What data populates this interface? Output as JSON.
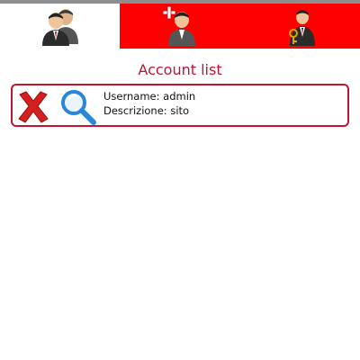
{
  "tabs": [
    {
      "name": "accounts",
      "icon": "users-icon",
      "active": true
    },
    {
      "name": "add-account",
      "icon": "add-user-icon",
      "active": false
    },
    {
      "name": "settings",
      "icon": "user-key-icon",
      "active": false
    }
  ],
  "page": {
    "title": "Account list"
  },
  "accounts": [
    {
      "username_line": "Username: admin",
      "description_line": "Descrizione: sito"
    }
  ],
  "icons": {
    "delete": "delete-x-icon",
    "view": "magnifier-icon"
  },
  "colors": {
    "tab_red": "#ff0000",
    "accent": "#c4122f",
    "topline": "#8e8e8e"
  }
}
